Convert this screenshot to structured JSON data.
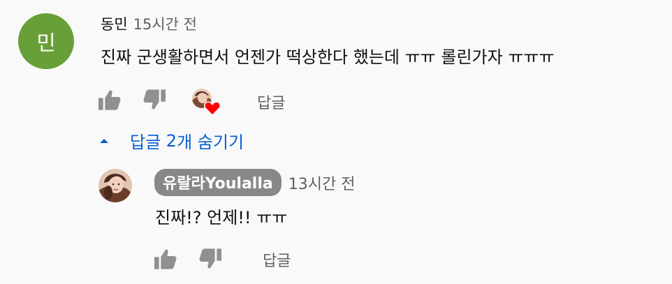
{
  "comment": {
    "avatar_initial": "민",
    "avatar_color": "#689f38",
    "author": "동민",
    "timestamp": "15시간 전",
    "text": "진짜 군생활하면서 언젠가 떡상한다 했는데 ㅠㅠ 롤린가자 ㅠㅠㅠ",
    "reply_label": "답글",
    "hearted_by_creator": true,
    "icons": [
      "thumb-up-icon",
      "thumb-down-icon",
      "creator-heart-icon"
    ]
  },
  "replies_toggle": {
    "prefix": "답글 ",
    "count": "2",
    "suffix": "개 숨기기",
    "icon": "caret-up-icon"
  },
  "reply": {
    "author": "유랄라Youlalla",
    "timestamp": "13시간 전",
    "text": "진짜!? 언제!! ㅠㅠ",
    "reply_label": "답글",
    "icons": [
      "thumb-up-icon",
      "thumb-down-icon"
    ]
  },
  "colors": {
    "background": "#f9f9f9",
    "link_blue": "#065fd4",
    "secondary_text": "#606060",
    "icon_gray": "#909090",
    "heart_red": "#ff0000",
    "owner_badge": "#888888"
  }
}
